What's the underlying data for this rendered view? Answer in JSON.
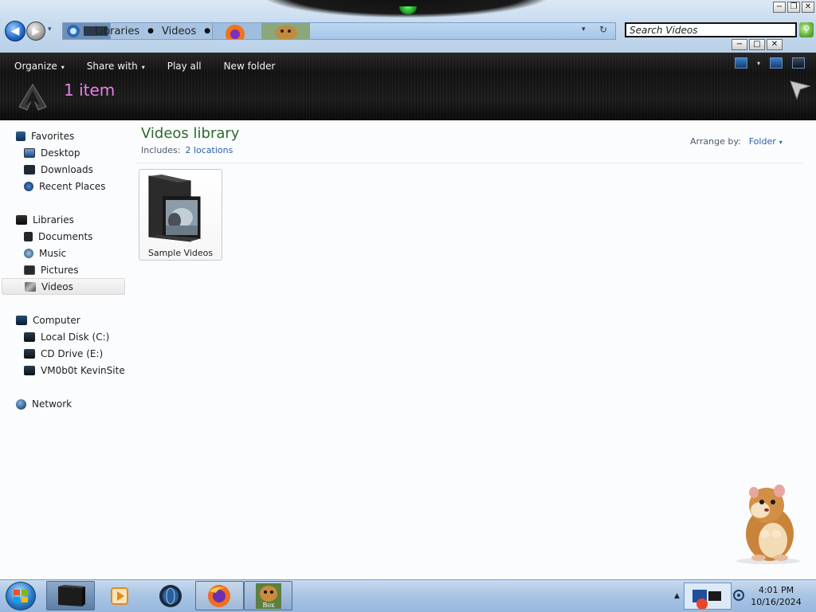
{
  "window": {
    "outer_controls": [
      "−",
      "❐",
      "✕"
    ],
    "inner_controls": [
      "−",
      "□",
      "✕"
    ]
  },
  "navigation": {
    "back_icon": "back-arrow-icon",
    "forward_icon": "forward-arrow-icon",
    "breadcrumbs": [
      "Libraries",
      "Videos"
    ],
    "separator": "▸",
    "dropdown": "▾",
    "refresh": "↻"
  },
  "search": {
    "placeholder": "Search Videos",
    "go_icon": "search-icon"
  },
  "toolbar": {
    "organize": "Organize",
    "share_with": "Share with",
    "play_all": "Play all",
    "new_folder": "New folder",
    "caret": "▾"
  },
  "status": {
    "item_count": "1 item"
  },
  "sidebar": {
    "favorites": {
      "label": "Favorites",
      "items": [
        "Desktop",
        "Downloads",
        "Recent Places"
      ]
    },
    "libraries": {
      "label": "Libraries",
      "items": [
        "Documents",
        "Music",
        "Pictures",
        "Videos"
      ],
      "selected": "Videos"
    },
    "computer": {
      "label": "Computer",
      "items": [
        "Local Disk (C:)",
        "CD Drive (E:)",
        "VM0b0t KevinSite"
      ]
    },
    "network": {
      "label": "Network"
    }
  },
  "library": {
    "title": "Videos library",
    "includes_label": "Includes:",
    "locations": "2 locations",
    "arrange_label": "Arrange by:",
    "arrange_value": "Folder",
    "arrange_caret": "▾"
  },
  "items": [
    {
      "name": "Sample Videos",
      "type": "folder"
    }
  ],
  "taskbar": {
    "time": "4:01 PM",
    "date": "10/16/2024",
    "pinned": [
      "explorer",
      "media-player",
      "browser-globe",
      "firefox",
      "game-box"
    ],
    "game_label": "Box",
    "tray_arrow": "▲"
  },
  "colors": {
    "accent_green": "#2e6a2e",
    "link_blue": "#2a5fb0",
    "status_pink": "#e880e8",
    "command_bar": "#141414",
    "taskbar": "#aac6e4"
  }
}
